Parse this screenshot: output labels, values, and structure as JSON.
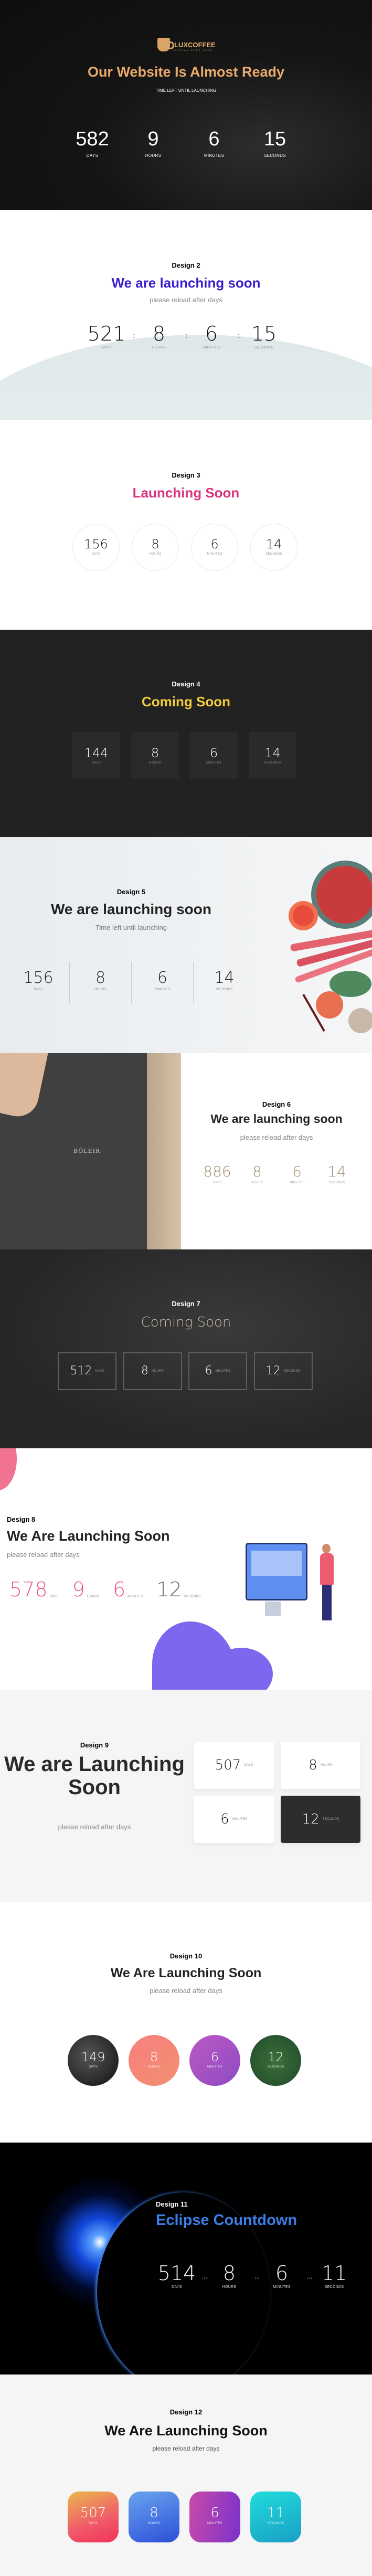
{
  "labels": [
    "DAYS",
    "HOURS",
    "MINUTES",
    "SECONDS"
  ],
  "d1": {
    "brand": "LUXCOFFEE",
    "slogan": "SLOGAN GOES HERE",
    "title": "Our Website Is Almost Ready",
    "subtitle": "TIME LEFT UNTIL LAUNCHING",
    "values": [
      "582",
      "9",
      "6",
      "15"
    ],
    "accent": "#e9ab6c"
  },
  "d2": {
    "label": "Design 2",
    "title": "We are launching soon",
    "subtitle": "please reload after days",
    "values": [
      "521",
      "8",
      "6",
      "15"
    ],
    "separator": ":",
    "accent": "#3a1fcc"
  },
  "d3": {
    "label": "Design 3",
    "title": "Launching Soon",
    "values": [
      "156",
      "8",
      "6",
      "14"
    ],
    "accent": "#d8337d"
  },
  "d4": {
    "label": "Design 4",
    "title": "Coming Soon",
    "values": [
      "144",
      "8",
      "6",
      "14"
    ],
    "accent": "#f4cf3c"
  },
  "d5": {
    "label": "Design 5",
    "title": "We are launching soon",
    "subtitle": "Time left until launching",
    "values": [
      "156",
      "8",
      "6",
      "14"
    ]
  },
  "d6": {
    "label": "Design 6",
    "brand": "BŌLEIR",
    "title": "We are launching soon",
    "subtitle": "please reload after days",
    "values": [
      "886",
      "8",
      "6",
      "14"
    ],
    "accent": "#a38c70"
  },
  "d7": {
    "label": "Design 7",
    "title": "Coming Soon",
    "values": [
      "512",
      "8",
      "6",
      "12"
    ]
  },
  "d8": {
    "label": "Design 8",
    "title": "We Are Launching Soon",
    "subtitle": "please reload after days",
    "values": [
      "578",
      "9",
      "6",
      "12"
    ],
    "accent": "#e8557a"
  },
  "d9": {
    "label": "Design 9",
    "title": "We are Launching Soon",
    "subtitle": "please reload after days",
    "values": [
      "507",
      "8",
      "6",
      "12"
    ]
  },
  "d10": {
    "label": "Design 10",
    "title": "We Are Launching Soon",
    "subtitle": "please reload after days",
    "values": [
      "149",
      "8",
      "6",
      "12"
    ]
  },
  "d11": {
    "label": "Design 11",
    "title": "Eclipse Countdown",
    "values": [
      "514",
      "8",
      "6",
      "11"
    ],
    "separator": "...",
    "accent": "#3d7de8"
  },
  "d12": {
    "label": "Design 12",
    "title": "We Are Launching Soon",
    "subtitle": "please reload after days",
    "values": [
      "507",
      "8",
      "6",
      "11"
    ]
  }
}
